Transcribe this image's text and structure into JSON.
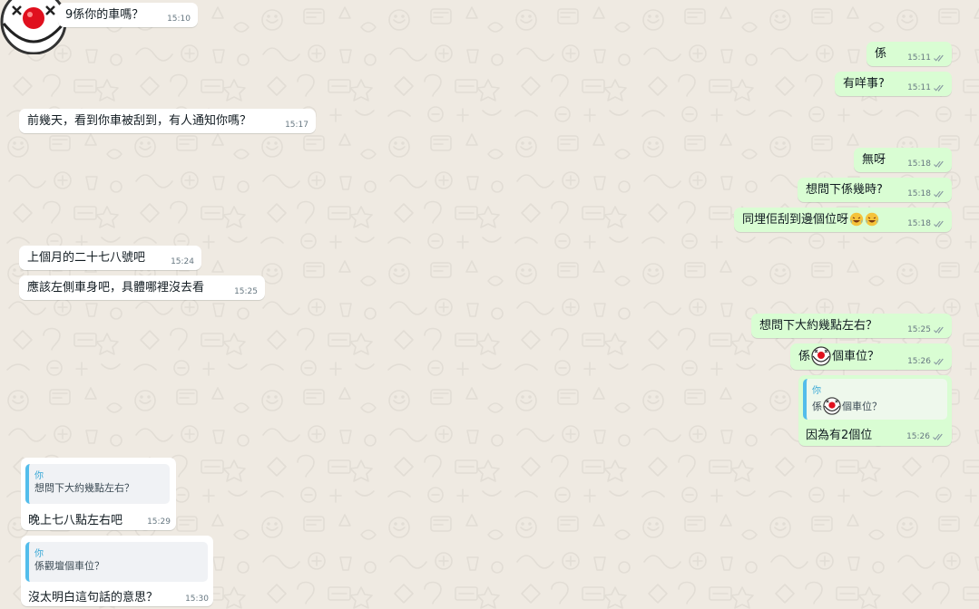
{
  "colors": {
    "background": "#efeae2",
    "outgoing_bubble": "#d9fdd3",
    "incoming_bubble": "#ffffff",
    "timestamp": "#667781",
    "read_ticks": "#8696a0",
    "quote_bar": "#53bdeb",
    "quote_author": "#35a7d6"
  },
  "messages": {
    "m1": {
      "text": "9係你的車嗎？",
      "time": "15:10"
    },
    "m2": {
      "text": "係",
      "time": "15:11"
    },
    "m3": {
      "text": "有咩事?",
      "time": "15:11"
    },
    "m4": {
      "text": "前幾天，看到你車被刮到，有人通知你嗎？",
      "time": "15:17"
    },
    "m5": {
      "text": "無呀",
      "time": "15:18"
    },
    "m6": {
      "text": "想問下係幾時?",
      "time": "15:18"
    },
    "m7": {
      "text": "同埋佢刮到邊個位呀",
      "time": "15:18",
      "emoji": [
        "rofl-emoji",
        "rofl-emoji"
      ]
    },
    "m8": {
      "text": "上個月的二十七八號吧",
      "time": "15:24"
    },
    "m9": {
      "text": "應該左側車身吧，具體哪裡沒去看",
      "time": "15:25"
    },
    "m10": {
      "text": "想問下大約幾點左右？",
      "time": "15:25"
    },
    "m11": {
      "text_before": "係",
      "text_after": "個車位？",
      "time": "15:26",
      "emoji": "clown-emoji"
    },
    "m12": {
      "quote_author": "你",
      "quote_before": "係",
      "quote_after": "個車位？",
      "quote_emoji": "clown-emoji",
      "text": "因為有2個位",
      "time": "15:26"
    },
    "m13": {
      "quote_author": "你",
      "quote_text": "想問下大約幾點左右？",
      "text": "晚上七八點左右吧",
      "time": "15:29"
    },
    "m14": {
      "quote_author": "你",
      "quote_text": "係觀壇個車位？",
      "text": "沒太明白這句話的意思？",
      "time": "15:30"
    }
  },
  "avatar": {
    "icon": "clown-avatar-icon"
  }
}
